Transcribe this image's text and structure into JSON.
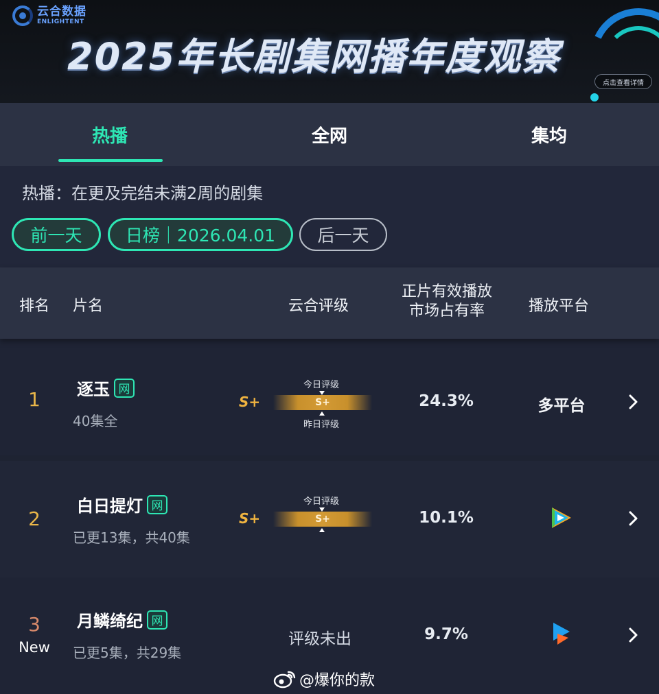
{
  "banner": {
    "logo_cn": "云合数据",
    "logo_en": "ENLIGHTENT",
    "title": "2025年长剧集网播年度观察",
    "detail_button": "点击查看详情"
  },
  "tabs": [
    {
      "label": "热播",
      "active": true
    },
    {
      "label": "全网",
      "active": false
    },
    {
      "label": "集均",
      "active": false
    }
  ],
  "info": {
    "description": "热播：在更及完结未满2周的剧集",
    "prev_day": "前一天",
    "date_label": "日榜｜2026.04.01",
    "next_day": "后一天"
  },
  "table": {
    "headers": {
      "rank": "排名",
      "name": "片名",
      "rating": "云合评级",
      "share": "正片有效播放\n市场占有率",
      "platform": "播放平台"
    },
    "rows": [
      {
        "rank": "1",
        "title": "逐玉",
        "badge": "网",
        "episodes": "40集全",
        "grade": "S+",
        "today_label": "今日评级",
        "today_grade": "S+",
        "yesterday_label": "昨日评级",
        "share": "24.3%",
        "platform": "多平台"
      },
      {
        "rank": "2",
        "title": "白日提灯",
        "badge": "网",
        "episodes": "已更13集，共40集",
        "grade": "S+",
        "today_label": "今日评级",
        "today_grade": "S+",
        "share": "10.1%",
        "platform_icon": "tencent-video-icon"
      },
      {
        "rank": "3",
        "new": "New",
        "title": "月鳞绮纪",
        "badge": "网",
        "episodes": "已更5集，共29集",
        "no_grade": "评级未出",
        "share": "9.7%",
        "platform_icon": "youku-icon"
      }
    ]
  },
  "footer": {
    "credit": "@爆你的款"
  },
  "colors": {
    "accent": "#2ee6b4",
    "gold": "#e9b649",
    "background": "#1e2332",
    "header": "#2c3244"
  }
}
